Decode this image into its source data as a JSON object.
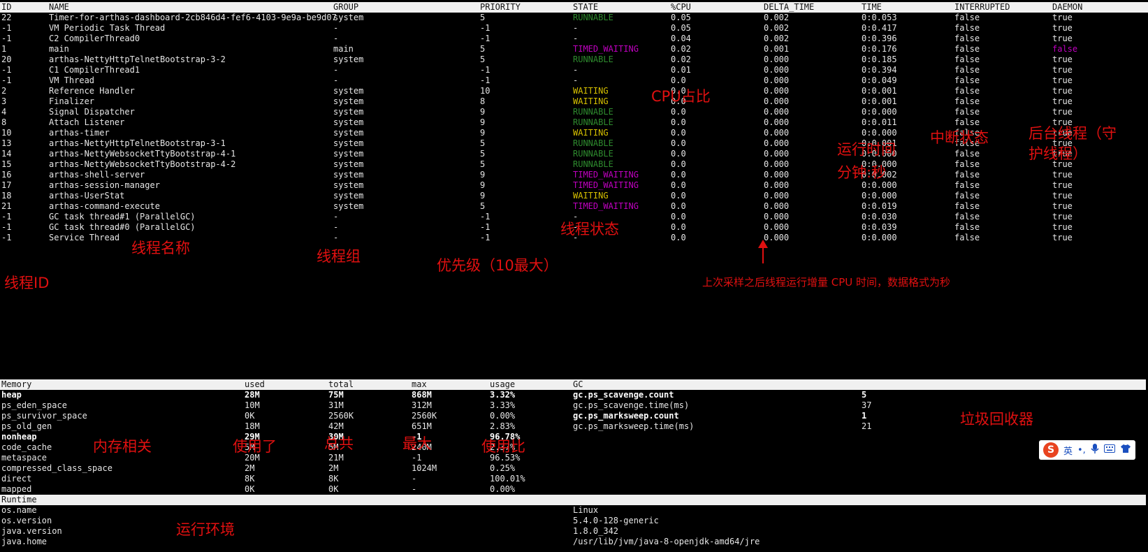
{
  "thread_table": {
    "headers": [
      "ID",
      "NAME",
      "GROUP",
      "PRIORITY",
      "STATE",
      "%CPU",
      "DELTA_TIME",
      "TIME",
      "INTERRUPTED",
      "DAEMON"
    ],
    "rows": [
      [
        "22",
        "Timer-for-arthas-dashboard-2cb846d4-fef6-4103-9e9a-be9d07",
        "system",
        "5",
        "RUNNABLE",
        "0.05",
        "0.002",
        "0:0.053",
        "false",
        "true"
      ],
      [
        "-1",
        "VM Periodic Task Thread",
        "-",
        "-1",
        "-",
        "0.05",
        "0.002",
        "0:0.417",
        "false",
        "true"
      ],
      [
        "-1",
        "C2 CompilerThread0",
        "-",
        "-1",
        "-",
        "0.04",
        "0.002",
        "0:0.396",
        "false",
        "true"
      ],
      [
        "1",
        "main",
        "main",
        "5",
        "TIMED_WAITING",
        "0.02",
        "0.001",
        "0:0.176",
        "false",
        "false"
      ],
      [
        "20",
        "arthas-NettyHttpTelnetBootstrap-3-2",
        "system",
        "5",
        "RUNNABLE",
        "0.02",
        "0.000",
        "0:0.185",
        "false",
        "true"
      ],
      [
        "-1",
        "C1 CompilerThread1",
        "-",
        "-1",
        "-",
        "0.01",
        "0.000",
        "0:0.394",
        "false",
        "true"
      ],
      [
        "-1",
        "VM Thread",
        "-",
        "-1",
        "-",
        "0.0",
        "0.000",
        "0:0.049",
        "false",
        "true"
      ],
      [
        "2",
        "Reference Handler",
        "system",
        "10",
        "WAITING",
        "0.0",
        "0.000",
        "0:0.001",
        "false",
        "true"
      ],
      [
        "3",
        "Finalizer",
        "system",
        "8",
        "WAITING",
        "0.0",
        "0.000",
        "0:0.001",
        "false",
        "true"
      ],
      [
        "4",
        "Signal Dispatcher",
        "system",
        "9",
        "RUNNABLE",
        "0.0",
        "0.000",
        "0:0.000",
        "false",
        "true"
      ],
      [
        "8",
        "Attach Listener",
        "system",
        "9",
        "RUNNABLE",
        "0.0",
        "0.000",
        "0:0.011",
        "false",
        "true"
      ],
      [
        "10",
        "arthas-timer",
        "system",
        "9",
        "WAITING",
        "0.0",
        "0.000",
        "0:0.000",
        "false",
        "true"
      ],
      [
        "13",
        "arthas-NettyHttpTelnetBootstrap-3-1",
        "system",
        "5",
        "RUNNABLE",
        "0.0",
        "0.000",
        "0:0.001",
        "false",
        "true"
      ],
      [
        "14",
        "arthas-NettyWebsocketTtyBootstrap-4-1",
        "system",
        "5",
        "RUNNABLE",
        "0.0",
        "0.000",
        "0:0.000",
        "false",
        "true"
      ],
      [
        "15",
        "arthas-NettyWebsocketTtyBootstrap-4-2",
        "system",
        "5",
        "RUNNABLE",
        "0.0",
        "0.000",
        "0:0.000",
        "false",
        "true"
      ],
      [
        "16",
        "arthas-shell-server",
        "system",
        "9",
        "TIMED_WAITING",
        "0.0",
        "0.000",
        "0:0.002",
        "false",
        "true"
      ],
      [
        "17",
        "arthas-session-manager",
        "system",
        "9",
        "TIMED_WAITING",
        "0.0",
        "0.000",
        "0:0.000",
        "false",
        "true"
      ],
      [
        "18",
        "arthas-UserStat",
        "system",
        "9",
        "WAITING",
        "0.0",
        "0.000",
        "0:0.000",
        "false",
        "true"
      ],
      [
        "21",
        "arthas-command-execute",
        "system",
        "5",
        "TIMED_WAITING",
        "0.0",
        "0.000",
        "0:0.019",
        "false",
        "true"
      ],
      [
        "-1",
        "GC task thread#1 (ParallelGC)",
        "-",
        "-1",
        "-",
        "0.0",
        "0.000",
        "0:0.030",
        "false",
        "true"
      ],
      [
        "-1",
        "GC task thread#0 (ParallelGC)",
        "-",
        "-1",
        "-",
        "0.0",
        "0.000",
        "0:0.039",
        "false",
        "true"
      ],
      [
        "-1",
        "Service Thread",
        "-",
        "-1",
        "-",
        "0.0",
        "0.000",
        "0:0.000",
        "false",
        "true"
      ]
    ]
  },
  "memory_table": {
    "headers": [
      "Memory",
      "used",
      "total",
      "max",
      "usage"
    ],
    "rows": [
      {
        "cells": [
          "heap",
          "28M",
          "75M",
          "868M",
          "3.32%"
        ],
        "bold": true
      },
      {
        "cells": [
          "ps_eden_space",
          "10M",
          "31M",
          "312M",
          "3.33%"
        ],
        "bold": false
      },
      {
        "cells": [
          "ps_survivor_space",
          "0K",
          "2560K",
          "2560K",
          "0.00%"
        ],
        "bold": false
      },
      {
        "cells": [
          "ps_old_gen",
          "18M",
          "42M",
          "651M",
          "2.83%"
        ],
        "bold": false
      },
      {
        "cells": [
          "nonheap",
          "29M",
          "30M",
          "-1",
          "96.78%"
        ],
        "bold": true
      },
      {
        "cells": [
          "code_cache",
          "5M",
          "5M",
          "240M",
          "2.37%"
        ],
        "bold": false
      },
      {
        "cells": [
          "metaspace",
          "20M",
          "21M",
          "-1",
          "96.53%"
        ],
        "bold": false
      },
      {
        "cells": [
          "compressed_class_space",
          "2M",
          "2M",
          "1024M",
          "0.25%"
        ],
        "bold": false
      },
      {
        "cells": [
          "direct",
          "8K",
          "8K",
          "-",
          "100.01%"
        ],
        "bold": false
      },
      {
        "cells": [
          "mapped",
          "0K",
          "0K",
          "-",
          "0.00%"
        ],
        "bold": false
      }
    ]
  },
  "gc_table": {
    "header": "GC",
    "rows": [
      {
        "cells": [
          "gc.ps_scavenge.count",
          "5"
        ],
        "bold": true
      },
      {
        "cells": [
          "gc.ps_scavenge.time(ms)",
          "37"
        ],
        "bold": false
      },
      {
        "cells": [
          "gc.ps_marksweep.count",
          "1"
        ],
        "bold": true
      },
      {
        "cells": [
          "gc.ps_marksweep.time(ms)",
          "21"
        ],
        "bold": false
      }
    ]
  },
  "runtime": {
    "header": "Runtime",
    "rows": [
      [
        "os.name",
        "Linux"
      ],
      [
        "os.version",
        "5.4.0-128-generic"
      ],
      [
        "java.version",
        "1.8.0_342"
      ],
      [
        "java.home",
        "/usr/lib/jvm/java-8-openjdk-amd64/jre"
      ]
    ]
  },
  "annotations": {
    "thread_id": "线程ID",
    "thread_name": "线程名称",
    "thread_group": "线程组",
    "priority": "优先级（10最大）",
    "thread_state": "线程状态",
    "cpu_ratio": "CPU占比",
    "run_time": "运行时间\n分钟:秒",
    "interrupted_state": "中断状态",
    "daemon": "后台线程（守\n护线程）",
    "delta_note": "上次采样之后线程运行增量 CPU 时间，数据格式为秒",
    "memory_related": "内存相关",
    "used": "使用了",
    "total": "总共",
    "max": "最大",
    "usage": "使用比",
    "gc": "垃圾回收器",
    "runtime_env": "运行环境"
  },
  "ime_toolbar": {
    "logo": "S",
    "lang": "英",
    "punct": "•,",
    "icons": [
      "mic-icon",
      "keyboard-icon",
      "shirt-icon"
    ]
  },
  "colors": {
    "runnable": "#2e8b2e",
    "timed_waiting": "#c000c0",
    "waiting": "#d6c000",
    "annotation": "#e01010"
  }
}
